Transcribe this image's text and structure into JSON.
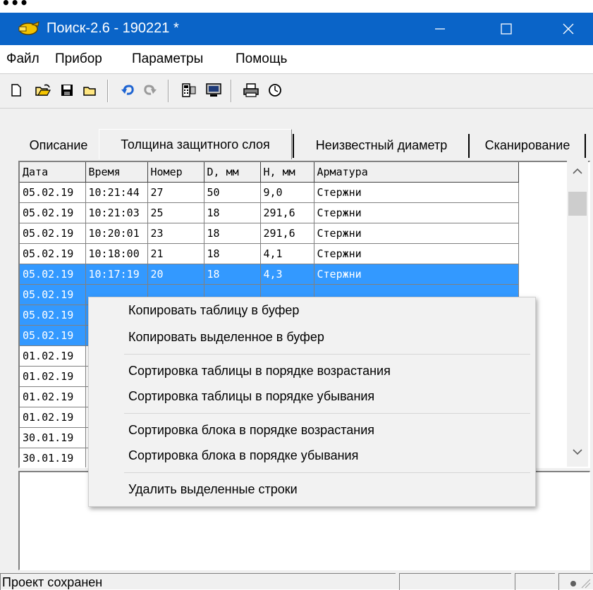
{
  "window": {
    "title": "Поиск-2.6 - 190221 *",
    "controls": {
      "minimize": "—",
      "maximize": "☐",
      "close": "✕"
    }
  },
  "menu": [
    "Файл",
    "Прибор",
    "Параметры",
    "Помощь"
  ],
  "toolbar": {
    "icons": [
      "new-file-icon",
      "open-folder-icon",
      "save-disk-icon",
      "folder-icon",
      "undo-icon",
      "redo-icon",
      "device-icon",
      "monitor-icon",
      "printer-icon",
      "clock-icon"
    ]
  },
  "tabs": [
    "Описание",
    "Толщина защитного слоя",
    "Неизвестный диаметр",
    "Сканирование"
  ],
  "active_tab": "Толщина защитного слоя",
  "table": {
    "columns": [
      "Дата",
      "Время",
      "Номер",
      "D, мм",
      "H, мм",
      "Арматура"
    ],
    "rows": [
      {
        "date": "05.02.19",
        "time": "10:21:44",
        "num": "27",
        "d": "50",
        "h": "9,0",
        "type": "Стержни",
        "selected": false
      },
      {
        "date": "05.02.19",
        "time": "10:21:03",
        "num": "25",
        "d": "18",
        "h": "291,6",
        "type": "Стержни",
        "selected": false
      },
      {
        "date": "05.02.19",
        "time": "10:20:01",
        "num": "23",
        "d": "18",
        "h": "291,6",
        "type": "Стержни",
        "selected": false
      },
      {
        "date": "05.02.19",
        "time": "10:18:00",
        "num": "21",
        "d": "18",
        "h": "4,1",
        "type": "Стержни",
        "selected": false
      },
      {
        "date": "05.02.19",
        "time": "10:17:19",
        "num": "20",
        "d": "18",
        "h": "4,3",
        "type": "Стержни",
        "selected": true
      },
      {
        "date": "05.02.19",
        "time": "",
        "num": "",
        "d": "",
        "h": "",
        "type": "",
        "selected": true
      },
      {
        "date": "05.02.19",
        "time": "",
        "num": "",
        "d": "",
        "h": "",
        "type": "",
        "selected": true
      },
      {
        "date": "05.02.19",
        "time": "",
        "num": "",
        "d": "",
        "h": "",
        "type": "",
        "selected": true
      },
      {
        "date": "01.02.19",
        "time": "",
        "num": "",
        "d": "",
        "h": "",
        "type": "",
        "selected": false
      },
      {
        "date": "01.02.19",
        "time": "",
        "num": "",
        "d": "",
        "h": "",
        "type": "",
        "selected": false
      },
      {
        "date": "01.02.19",
        "time": "",
        "num": "",
        "d": "",
        "h": "",
        "type": "",
        "selected": false
      },
      {
        "date": "01.02.19",
        "time": "",
        "num": "",
        "d": "",
        "h": "",
        "type": "",
        "selected": false
      },
      {
        "date": "30.01.19",
        "time": "",
        "num": "",
        "d": "",
        "h": "",
        "type": "",
        "selected": false
      },
      {
        "date": "30.01.19",
        "time": "",
        "num": "",
        "d": "",
        "h": "",
        "type": "",
        "selected": false
      }
    ]
  },
  "context_menu": {
    "items": [
      "Копировать таблицу в буфер",
      "Копировать выделенное в буфер",
      "Сортировка таблицы в порядке возрастания",
      "Сортировка таблицы в порядке убывания",
      "Сортировка блока в порядке возрастания",
      "Сортировка блока в порядке убывания",
      "Удалить выделенные строки"
    ]
  },
  "statusbar": {
    "text": "Проект сохранен"
  },
  "colors": {
    "titlebar": "#0a64c8",
    "selection": "#3399ff",
    "face": "#f0f0f0"
  }
}
